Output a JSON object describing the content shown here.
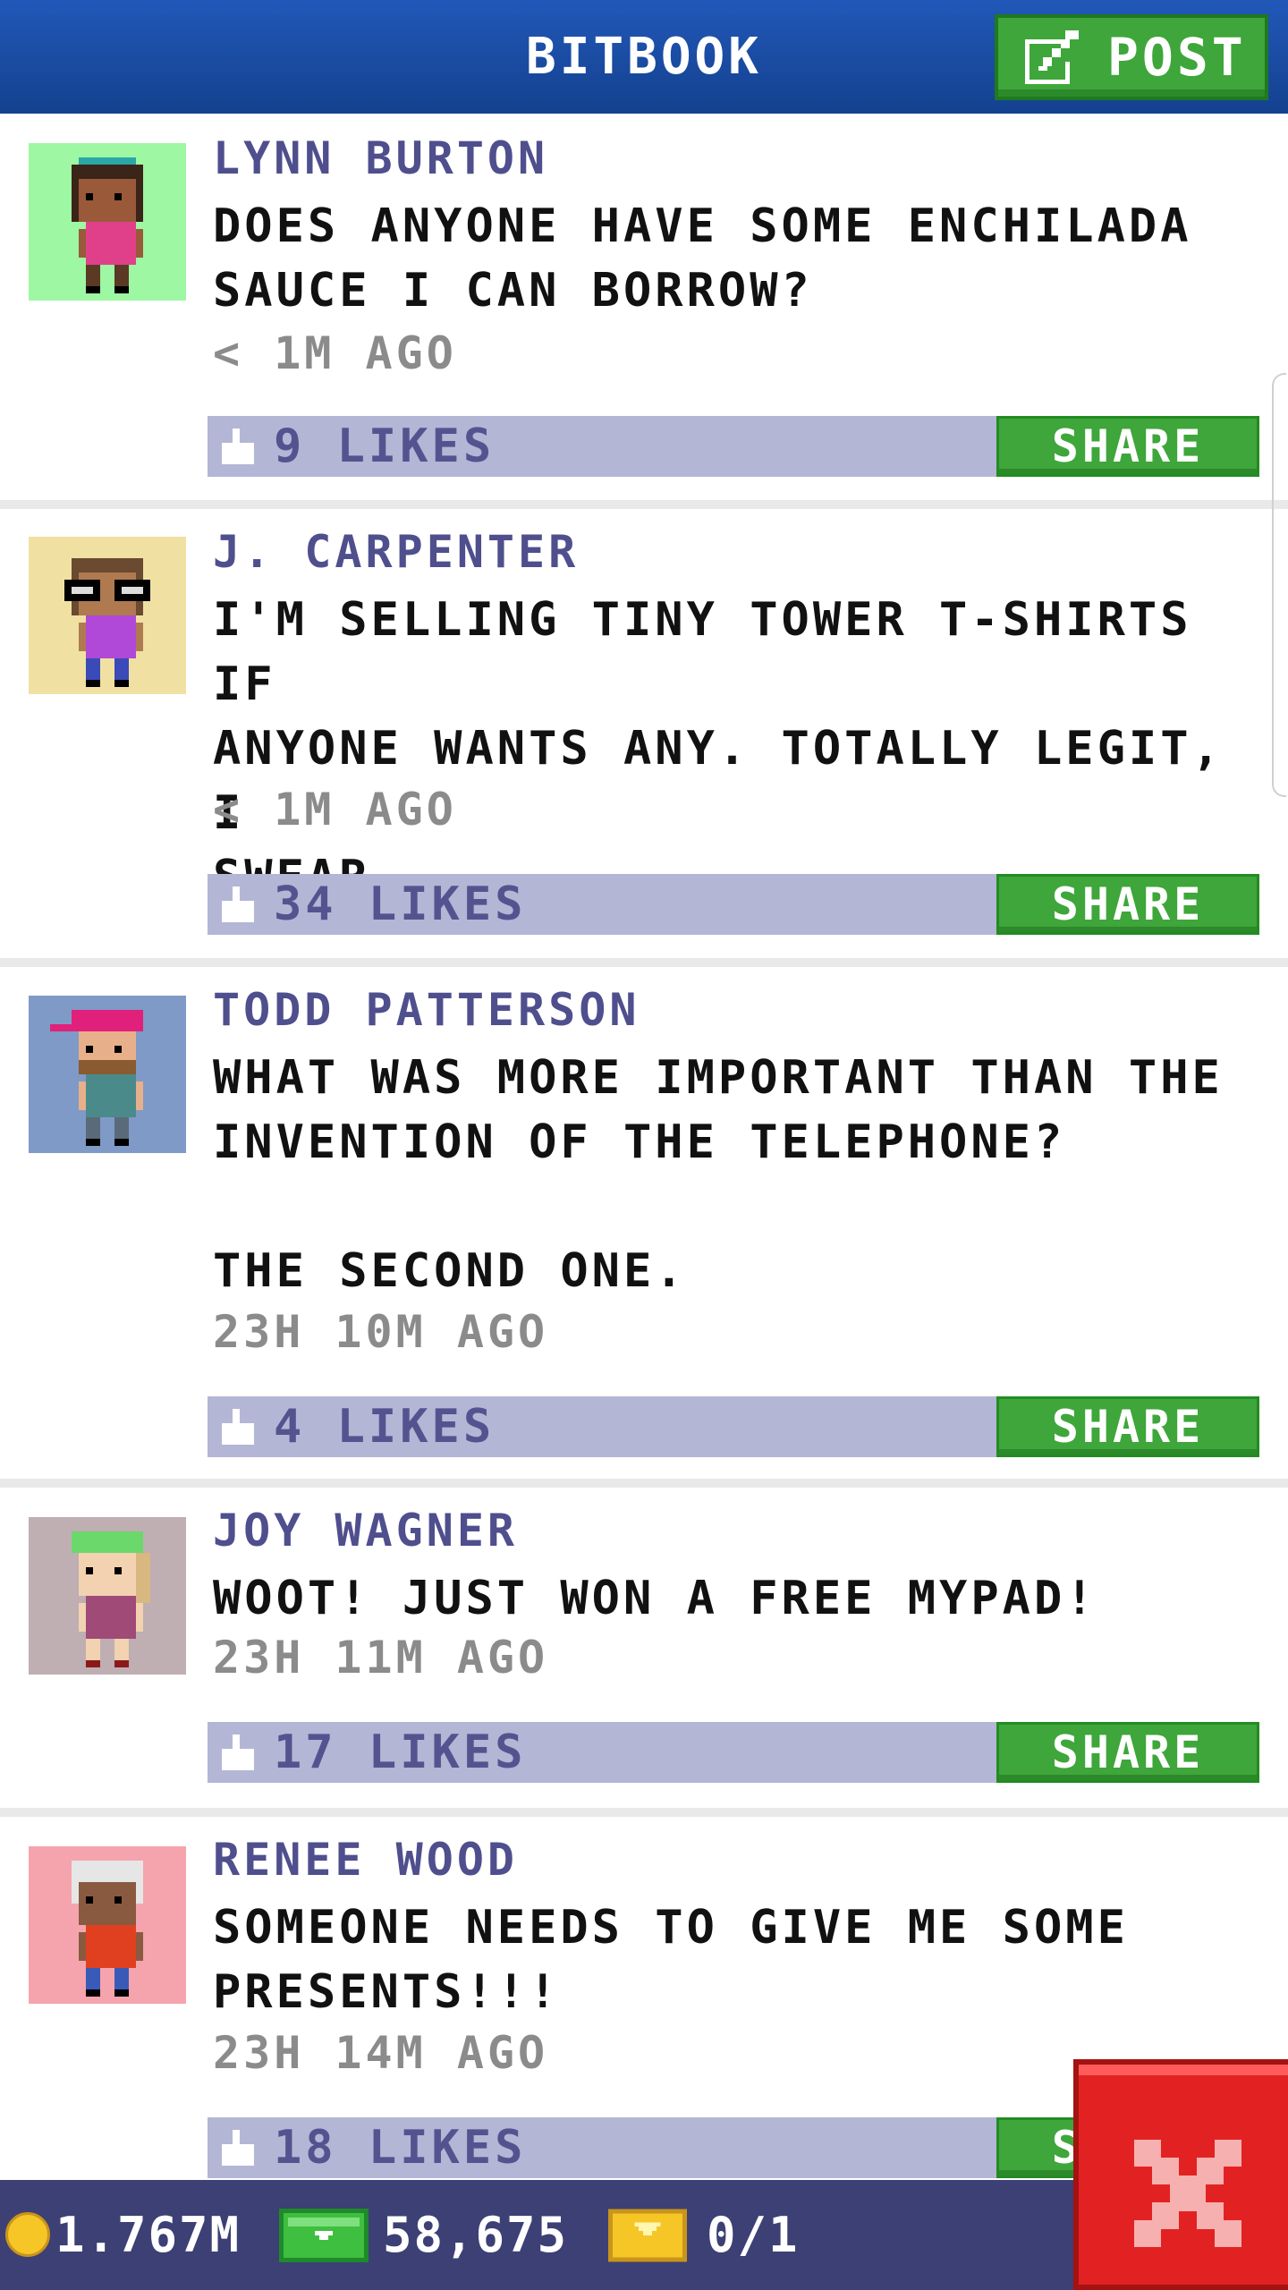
{
  "header": {
    "title": "BITBOOK",
    "post_label": "POST"
  },
  "posts": [
    {
      "name": "LYNN BURTON",
      "message": "DOES ANYONE HAVE SOME ENCHILADA\nSAUCE I CAN BORROW?",
      "time": "< 1M AGO",
      "likes": "9 LIKES",
      "share": "SHARE",
      "avatar_bg": "#9ef7a3"
    },
    {
      "name": "J. CARPENTER",
      "message": "I'M SELLING TINY TOWER T-SHIRTS IF\nANYONE WANTS ANY. TOTALLY LEGIT, I\nSWEAR.",
      "time": "< 1M AGO",
      "likes": "34 LIKES",
      "share": "SHARE",
      "avatar_bg": "#f0e1a2"
    },
    {
      "name": "TODD PATTERSON",
      "message": "WHAT WAS MORE IMPORTANT THAN THE\nINVENTION OF THE TELEPHONE?\n\nTHE SECOND ONE.",
      "time": "23H 10M AGO",
      "likes": "4 LIKES",
      "share": "SHARE",
      "avatar_bg": "#7f9ac6"
    },
    {
      "name": "JOY WAGNER",
      "message": "WOOT! JUST WON A FREE MYPAD!",
      "time": "23H 11M AGO",
      "likes": "17 LIKES",
      "share": "SHARE",
      "avatar_bg": "#bfaeb2"
    },
    {
      "name": "RENEE WOOD",
      "message": "SOMEONE NEEDS TO GIVE ME SOME\nPRESENTS!!!",
      "time": "23H 14M AGO",
      "likes": "18 LIKES",
      "share": "SHARE",
      "avatar_bg": "#f5a4ad"
    }
  ],
  "status": {
    "coins": "1.767M",
    "bux": "58,675",
    "tickets": "0/1"
  },
  "icons": {
    "post": "edit-icon",
    "like": "thumbs-up-icon",
    "coin": "coin-icon",
    "bux": "bux-icon",
    "ticket": "golden-ticket-icon",
    "close": "close-icon"
  },
  "colors": {
    "header": "#1d4fae",
    "accent_green": "#3ea63a",
    "like_bar": "#b4b6d6",
    "name_text": "#4f4f8e",
    "bottom_bar": "#3c4074",
    "close_red": "#e22222"
  }
}
